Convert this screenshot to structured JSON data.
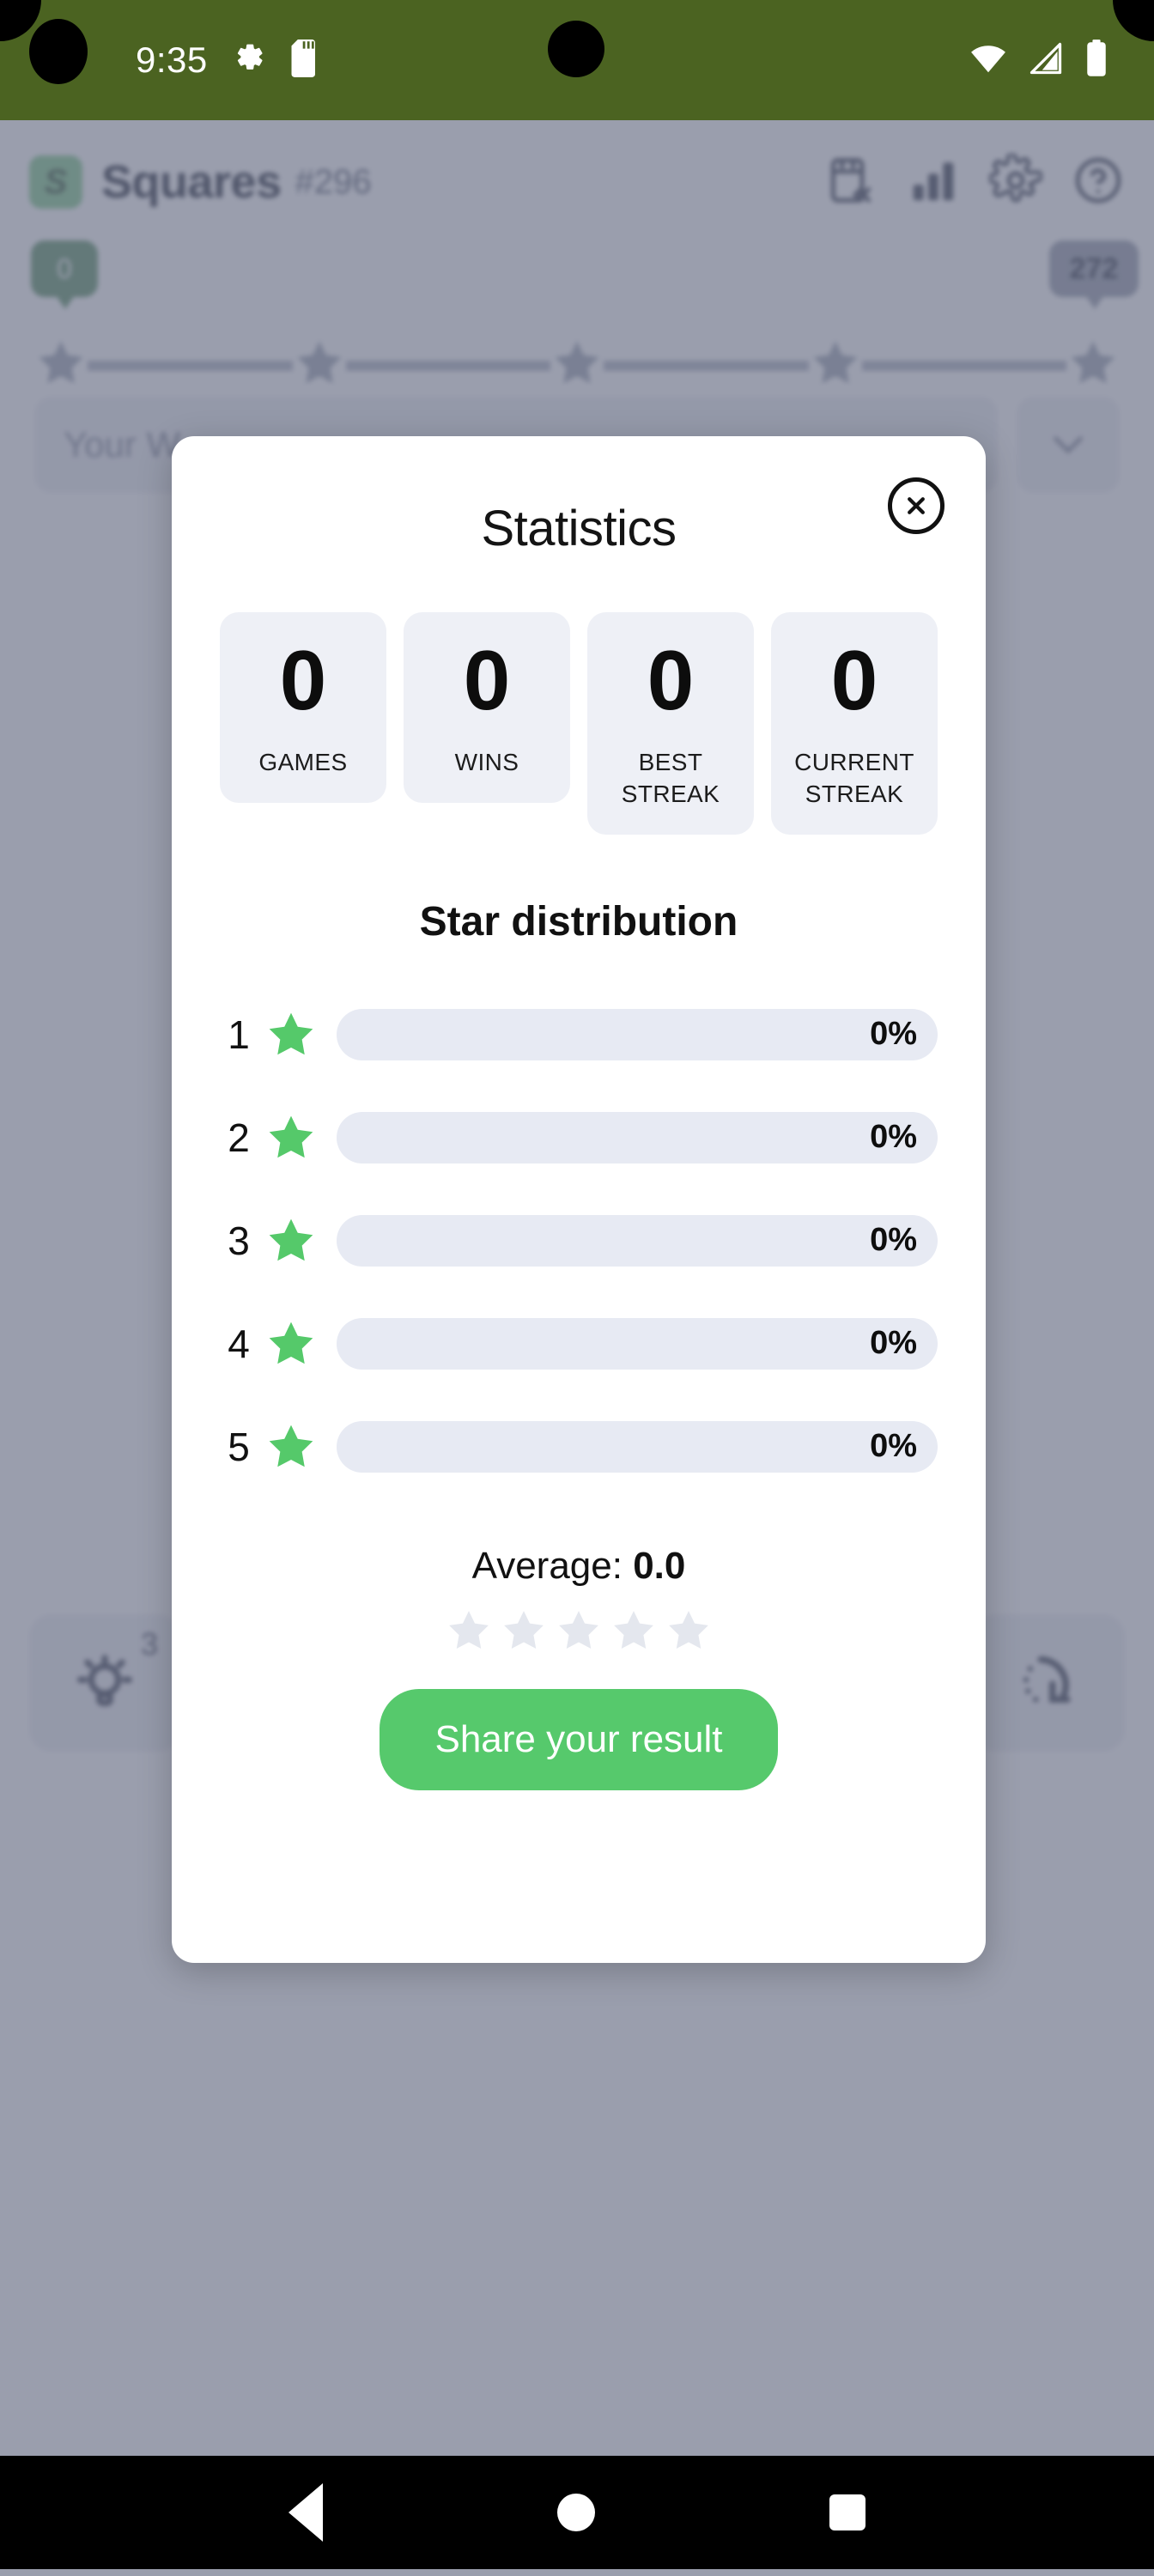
{
  "status_bar": {
    "time": "9:35",
    "icons": [
      "gear-icon",
      "sd-card-icon",
      "wifi-icon",
      "cellular-signal-icon",
      "battery-icon"
    ],
    "background_color": "#4b6321"
  },
  "app": {
    "logo_letter": "S",
    "title": "Squares",
    "puzzle_number": "#296",
    "header_icons": [
      "archive-calendar-icon",
      "bar-chart-icon",
      "gear-icon",
      "help-icon"
    ],
    "progress": {
      "start_badge": "0",
      "end_badge": "272",
      "star_count": 5
    },
    "guess_input_placeholder": "Your W",
    "dropdown_icon": "chevron-down-icon",
    "tools": {
      "hint_icon": "lightbulb-icon",
      "hint_count": "3",
      "skip_icon": "rotate-skip-icon"
    }
  },
  "modal": {
    "title": "Statistics",
    "close_icon": "close-circle-icon",
    "stats": [
      {
        "value": "0",
        "label": "GAMES",
        "tall": false
      },
      {
        "value": "0",
        "label": "WINS",
        "tall": false
      },
      {
        "value": "0",
        "label": "BEST\nSTREAK",
        "tall": true
      },
      {
        "value": "0",
        "label": "CURRENT\nSTREAK",
        "tall": true
      }
    ],
    "distribution_title": "Star distribution",
    "distribution": [
      {
        "stars": "1",
        "percent": "0%",
        "value": 0
      },
      {
        "stars": "2",
        "percent": "0%",
        "value": 0
      },
      {
        "stars": "3",
        "percent": "0%",
        "value": 0
      },
      {
        "stars": "4",
        "percent": "0%",
        "value": 0
      },
      {
        "stars": "5",
        "percent": "0%",
        "value": 0
      }
    ],
    "average_label": "Average:",
    "average_value": "0.0",
    "average_stars_filled": 0,
    "average_stars_total": 5,
    "share_button": "Share your result",
    "colors": {
      "accent_green": "#56c96c",
      "star_green": "#55c96a",
      "bar_track": "#e7eaf3",
      "card_bg": "#eef0f6",
      "empty_star": "#e4e7ee"
    }
  },
  "nav_bar": {
    "back_icon": "back-triangle-icon",
    "home_icon": "home-circle-icon",
    "recents_icon": "recents-square-icon"
  },
  "chart_data": {
    "type": "bar",
    "title": "Star distribution",
    "categories": [
      "1",
      "2",
      "3",
      "4",
      "5"
    ],
    "values": [
      0,
      0,
      0,
      0,
      0
    ],
    "value_labels": [
      "0%",
      "0%",
      "0%",
      "0%",
      "0%"
    ],
    "xlabel": "",
    "ylabel": "",
    "ylim": [
      0,
      100
    ],
    "orientation": "horizontal",
    "grid": false,
    "legend": "none",
    "annotations": {
      "average": "0.0",
      "games": 0,
      "wins": 0,
      "best_streak": 0,
      "current_streak": 0
    }
  }
}
